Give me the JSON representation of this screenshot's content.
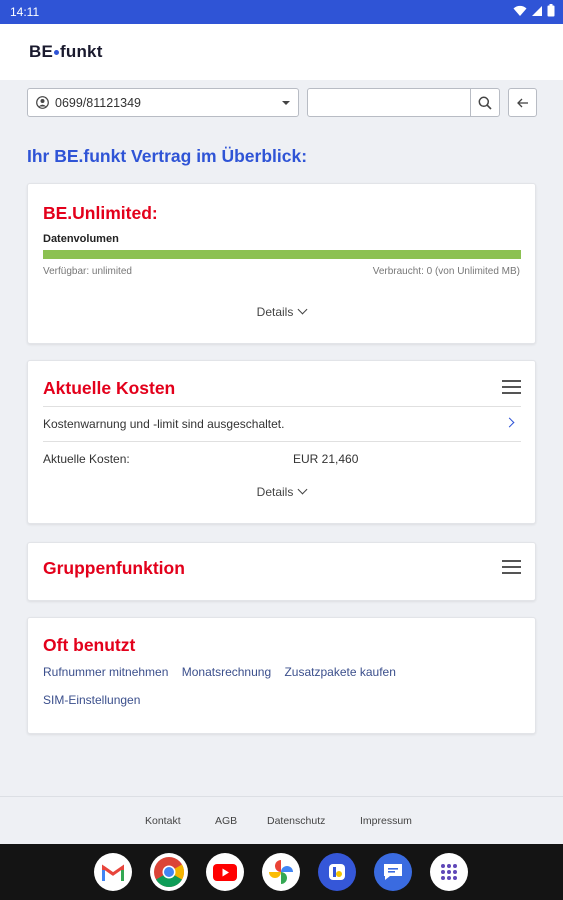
{
  "status_bar": {
    "time": "14:11"
  },
  "header": {
    "logo_part1": "BE",
    "logo_part2": "funkt"
  },
  "toolbar": {
    "phone_number": "0699/81121349",
    "search_value": ""
  },
  "page_title": "Ihr BE.funkt Vertrag im Überblick:",
  "plan_card": {
    "title": "BE.Unlimited:",
    "data_label": "Datenvolumen",
    "available": "Verfügbar: unlimited",
    "used": "Verbraucht: 0 (von Unlimited MB)",
    "usage_fill_fraction": 1.0,
    "details": "Details"
  },
  "costs_card": {
    "title": "Aktuelle Kosten",
    "warning_text": "Kostenwarnung und -limit sind ausgeschaltet.",
    "current_costs_label": "Aktuelle Kosten:",
    "current_costs_value": "EUR 21,460",
    "details": "Details"
  },
  "group_card": {
    "title": "Gruppenfunktion"
  },
  "frequent_card": {
    "title": "Oft benutzt",
    "links": [
      "Rufnummer mitnehmen",
      "Monatsrechnung",
      "Zusatzpakete kaufen",
      "SIM-Einstellungen"
    ]
  },
  "footer": {
    "links": [
      "Kontakt",
      "AGB",
      "Datenschutz",
      "Impressum"
    ]
  },
  "colors": {
    "brand_blue": "#2f54d6",
    "accent_red": "#e3001b",
    "bar_green": "#8cc152"
  },
  "dock_apps": [
    "gmail-icon",
    "chrome-icon",
    "youtube-icon",
    "photos-icon",
    "befunkt-app-icon",
    "messages-icon",
    "app-drawer-icon"
  ]
}
